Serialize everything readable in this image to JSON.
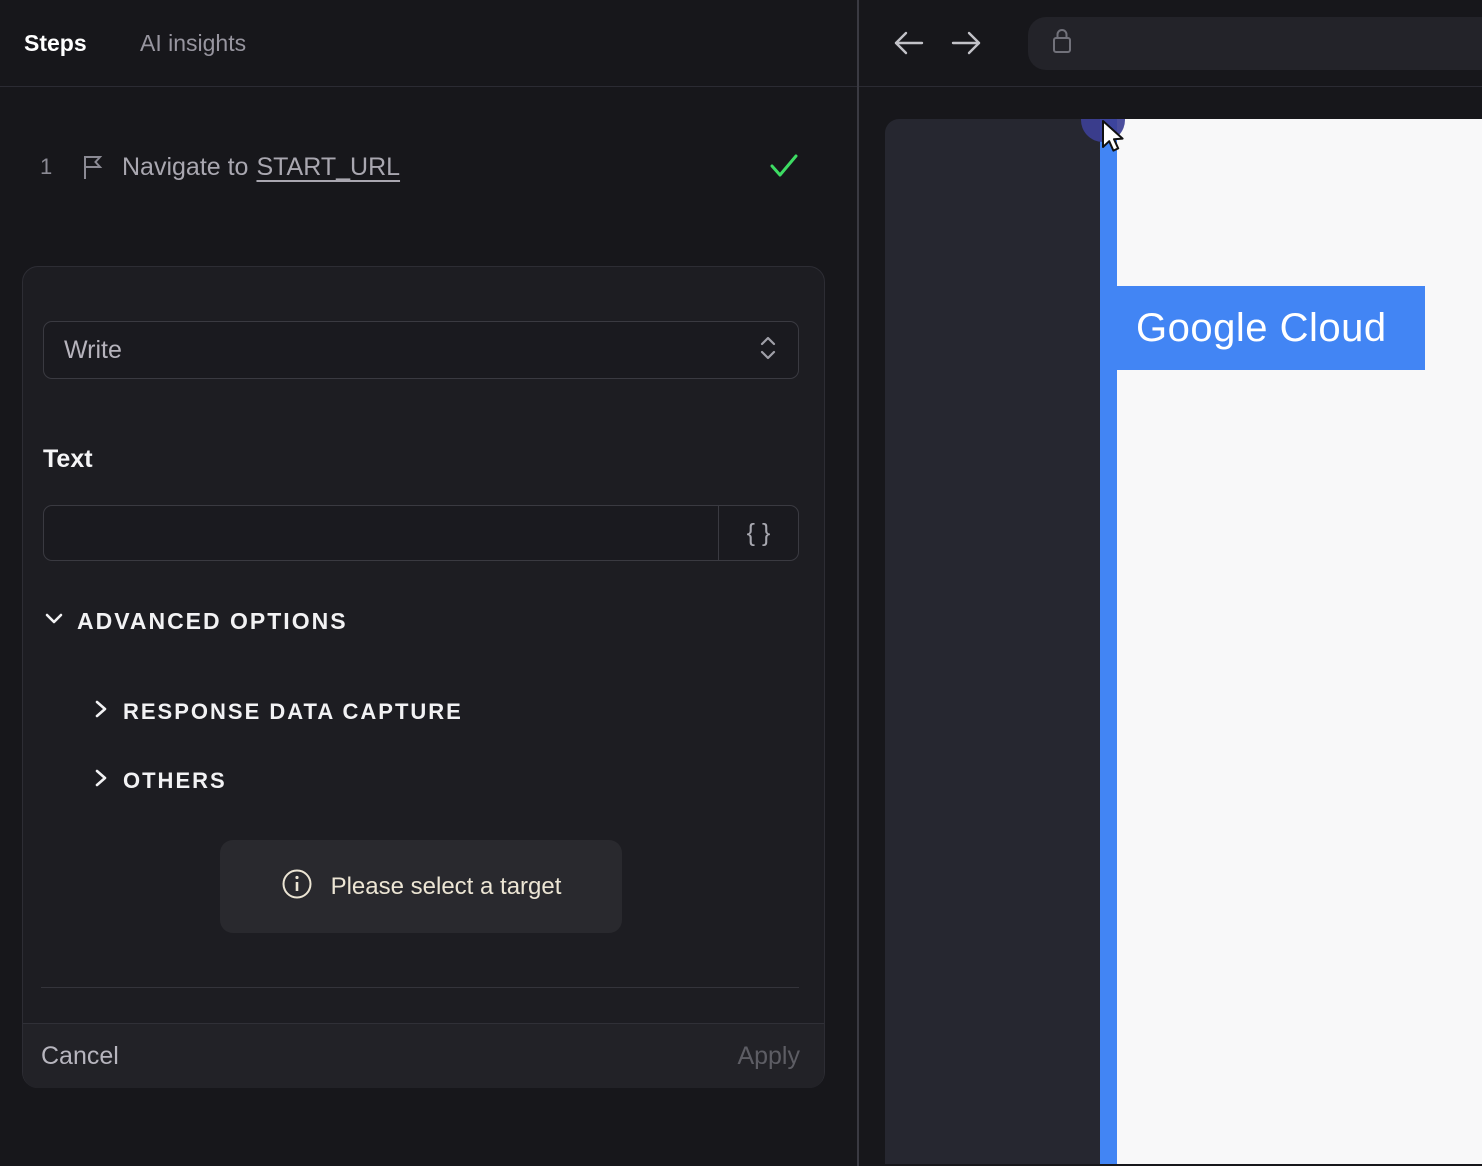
{
  "left_panel": {
    "tabs": [
      {
        "label": "Steps",
        "active": true
      },
      {
        "label": "AI insights",
        "active": false
      }
    ],
    "step": {
      "index": "1",
      "action_text": "Navigate to",
      "target_text": "START_URL",
      "status": "success"
    },
    "editor": {
      "action_select": {
        "value": "Write"
      },
      "text_field": {
        "label": "Text",
        "value": "",
        "placeholder": ""
      },
      "variable_button_label": "{ }",
      "advanced_options_label": "ADVANCED OPTIONS",
      "sections": [
        {
          "label": "RESPONSE DATA CAPTURE",
          "expanded": false
        },
        {
          "label": "OTHERS",
          "expanded": false
        }
      ],
      "notice_text": "Please select a target",
      "footer": {
        "cancel_label": "Cancel",
        "apply_label": "Apply"
      }
    }
  },
  "browser": {
    "address_bar": {
      "value": "",
      "icon": "lock-icon"
    },
    "nav_icons": [
      "arrow-left-icon",
      "arrow-right-icon"
    ],
    "page": {
      "banner_text": "Google Cloud"
    }
  },
  "colors": {
    "accent_blue": "#4285f4",
    "success_green": "#3ddc63",
    "notice_cream": "#ece5d4",
    "panel_bg": "#17171b",
    "card_bg": "#1d1d22",
    "viewport_slate": "#262730",
    "selection_dot_indigo": "#3c3f95"
  }
}
